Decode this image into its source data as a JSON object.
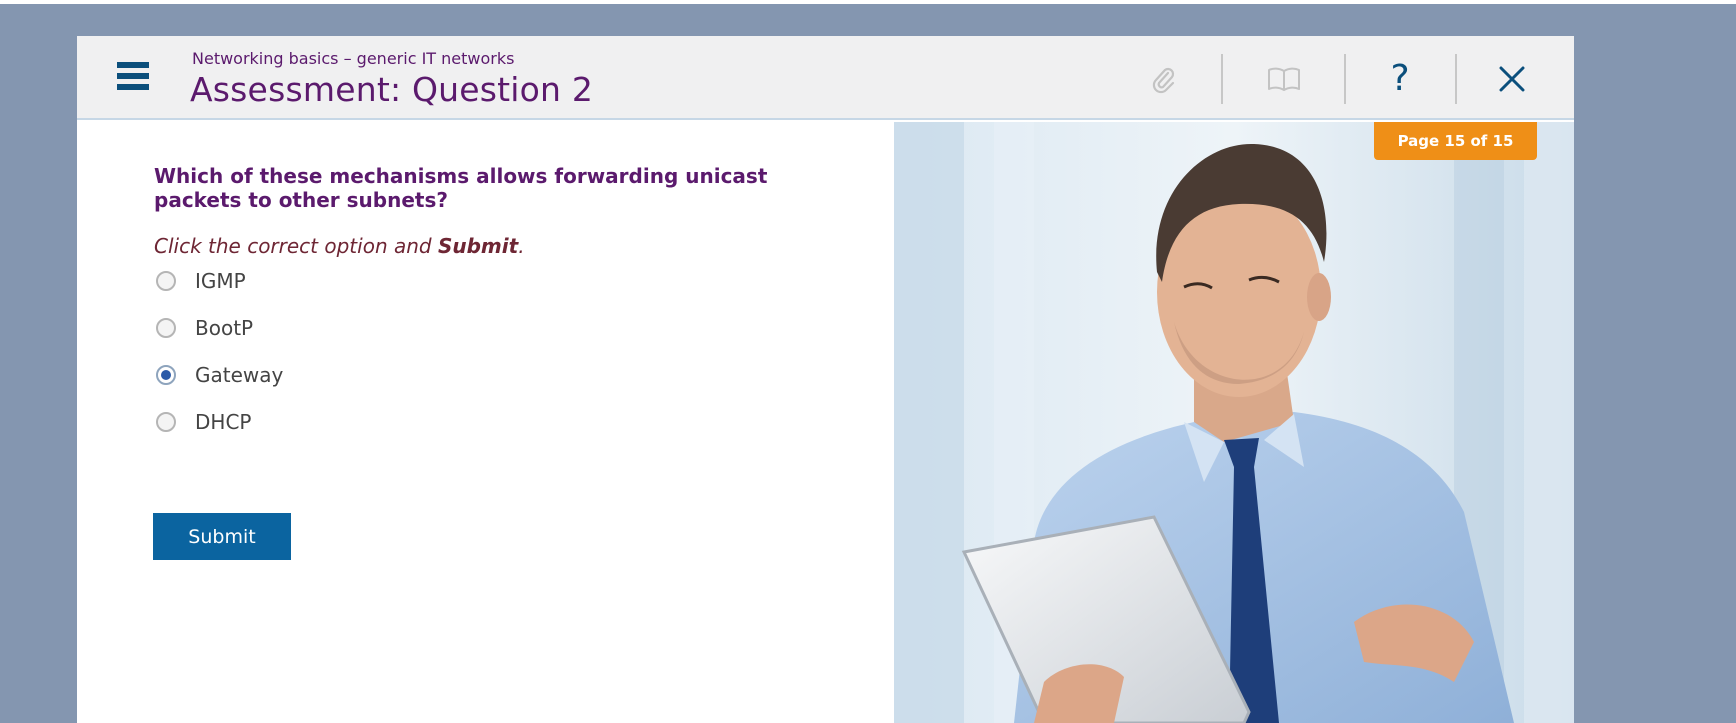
{
  "header": {
    "subtitle": "Networking basics – generic IT networks",
    "title": "Assessment: Question 2",
    "icons": [
      "menu-icon",
      "paperclip-icon",
      "book-icon",
      "help-icon",
      "close-icon"
    ]
  },
  "question": {
    "text": "Which of these mechanisms allows forwarding unicast packets to other subnets?",
    "instruction_prefix": "Click the correct option and ",
    "instruction_bold": "Submit",
    "instruction_suffix": ".",
    "options": [
      {
        "label": "IGMP",
        "selected": false
      },
      {
        "label": "BootP",
        "selected": false
      },
      {
        "label": "Gateway",
        "selected": true
      },
      {
        "label": "DHCP",
        "selected": false
      }
    ],
    "submit_label": "Submit"
  },
  "page_badge": "Page 15 of 15",
  "colors": {
    "background": "#8496b0",
    "title": "#5b1a6d",
    "submit": "#0b64a0",
    "badge": "#ef8f17",
    "icon_blue": "#0b4f7c"
  }
}
